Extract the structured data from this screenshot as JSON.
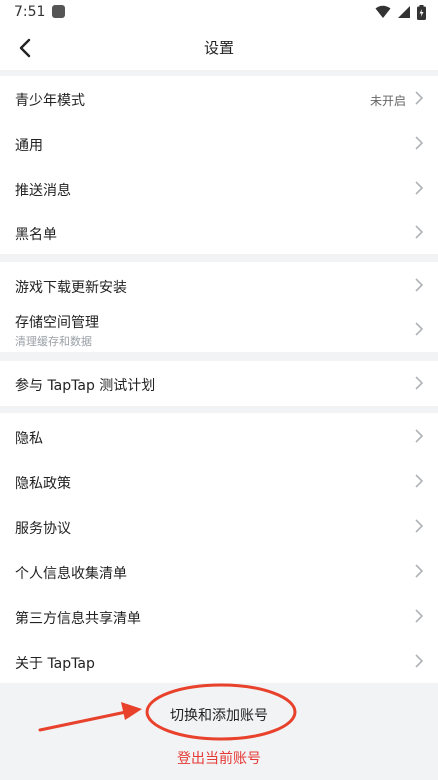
{
  "status": {
    "time": "7:51"
  },
  "header": {
    "title": "设置"
  },
  "groups": [
    {
      "items": [
        {
          "label": "青少年模式",
          "value": "未开启"
        },
        {
          "label": "通用"
        },
        {
          "label": "推送消息"
        },
        {
          "label": "黑名单"
        }
      ]
    },
    {
      "items": [
        {
          "label": "游戏下载更新安装"
        },
        {
          "label": "存储空间管理",
          "sub": "清理缓存和数据"
        }
      ]
    },
    {
      "items": [
        {
          "label": "参与 TapTap 测试计划"
        }
      ]
    },
    {
      "items": [
        {
          "label": "隐私"
        },
        {
          "label": "隐私政策"
        },
        {
          "label": "服务协议"
        },
        {
          "label": "个人信息收集清单"
        },
        {
          "label": "第三方信息共享清单"
        },
        {
          "label": "关于 TapTap"
        }
      ]
    }
  ],
  "footer": {
    "switch_label": "切换和添加账号",
    "logout_label": "登出当前账号"
  },
  "colors": {
    "accent_red": "#e53935",
    "annotation_red": "#e8412c"
  }
}
